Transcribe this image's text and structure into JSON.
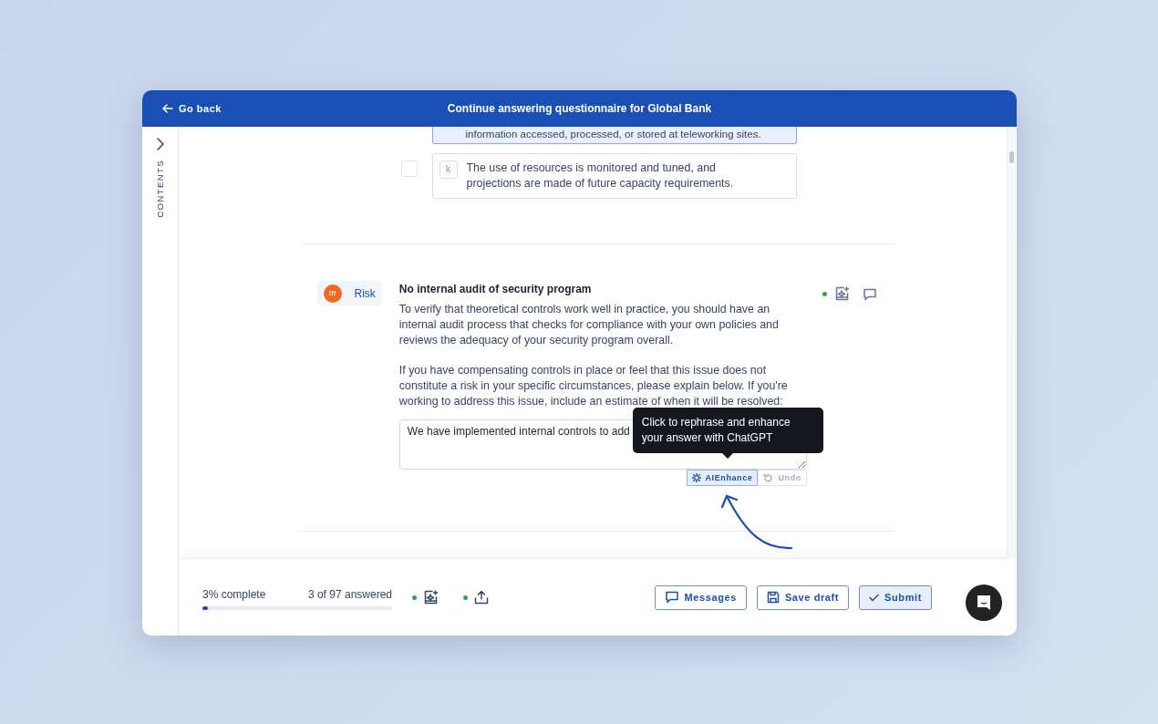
{
  "header": {
    "back_label": "Go back",
    "title": "Continue answering questionnaire for Global Bank"
  },
  "sidebar": {
    "label": "CONTENTS"
  },
  "options": [
    {
      "kind": "partial",
      "text": "information accessed, processed, or stored at teleworking sites.",
      "selected": true
    },
    {
      "kind": "full",
      "letter": "k",
      "text": "The use of resources is monitored and tuned, and projections are made of future capacity requirements.",
      "selected": false,
      "checked": false
    }
  ],
  "question": {
    "badge": {
      "icon": "!!!",
      "label": "Risk"
    },
    "title": "No internal audit of security program",
    "paragraphs": [
      "To verify that theoretical controls work well in practice, you should have an internal audit process that checks for compliance with your own policies and reviews the adequacy of your security program overall.",
      "If you have compensating controls in place or feel that this issue does not constitute a risk in your specific circumstances, please explain below. If you're working to address this issue, include an estimate of when it will be resolved:"
    ],
    "answer": "We have implemented internal controls to add",
    "actions": [
      {
        "kind": "enhance",
        "label": "AIEnhance",
        "disabled": false
      },
      {
        "kind": "undo",
        "label": "Undo",
        "disabled": true
      }
    ],
    "tooltip": "Click to rephrase and enhance your answer with ChatGPT"
  },
  "footer": {
    "progress_label": "3% complete",
    "answered": "3 of 97 answered",
    "level": 0.03,
    "tools": [
      {
        "kind": "ai"
      },
      {
        "kind": "upload"
      }
    ],
    "buttons": [
      {
        "kind": "messages",
        "label": "Messages",
        "primary": false
      },
      {
        "kind": "save",
        "label": "Save draft",
        "primary": false
      },
      {
        "kind": "submit",
        "label": "Submit",
        "primary": true
      }
    ]
  }
}
